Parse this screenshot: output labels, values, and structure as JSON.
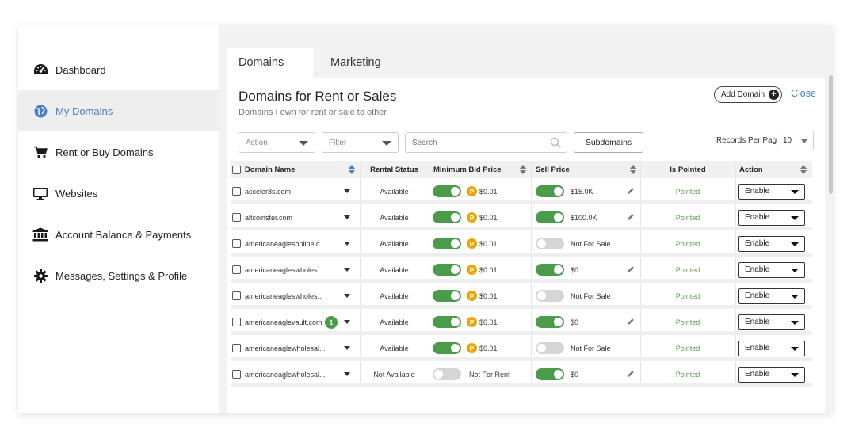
{
  "sidebar": {
    "items": [
      {
        "label": "Dashboard",
        "icon": "dashboard-icon"
      },
      {
        "label": "My Domains",
        "icon": "globe-icon"
      },
      {
        "label": "Rent or Buy Domains",
        "icon": "cart-icon"
      },
      {
        "label": "Websites",
        "icon": "monitor-icon"
      },
      {
        "label": "Account Balance & Payments",
        "icon": "bank-icon"
      },
      {
        "label": "Messages, Settings & Profile",
        "icon": "gear-icon"
      }
    ],
    "active_index": 1
  },
  "tabs": [
    {
      "label": "Domains",
      "active": true
    },
    {
      "label": "Marketing",
      "active": false
    }
  ],
  "panel": {
    "title": "Domains for Rent or Sales",
    "subtitle": "Domains I own for rent or sale to other",
    "add_domain_label": "Add Domain",
    "close_label": "Close"
  },
  "filters": {
    "action_placeholder": "Action",
    "filter_placeholder": "Filter",
    "search_placeholder": "Search",
    "subdomains_label": "Subdomains",
    "records_per_page_label": "Records Per Page",
    "records_per_page_value": "10"
  },
  "columns": {
    "domain_name": "Domain Name",
    "rental_status": "Rental Status",
    "min_bid": "Minimum Bid Price",
    "sell_price": "Sell Price",
    "is_pointed": "Is Pointed",
    "action": "Action"
  },
  "rows": [
    {
      "domain": "acceler8s.com",
      "badge": "",
      "rental": "Available",
      "rent_on": true,
      "bid": "$0.01",
      "sell_on": true,
      "sell": "$15.0K",
      "editable": true,
      "pointed": "Pointed",
      "action": "Enable"
    },
    {
      "domain": "altcoinster.com",
      "badge": "",
      "rental": "Available",
      "rent_on": true,
      "bid": "$0.01",
      "sell_on": true,
      "sell": "$100.0K",
      "editable": true,
      "pointed": "Pointed",
      "action": "Enable"
    },
    {
      "domain": "americaneaglesonline.c...",
      "badge": "",
      "rental": "Available",
      "rent_on": true,
      "bid": "$0.01",
      "sell_on": false,
      "sell": "Not For Sale",
      "editable": false,
      "pointed": "Pointed",
      "action": "Enable"
    },
    {
      "domain": "americaneagleswholes...",
      "badge": "",
      "rental": "Available",
      "rent_on": true,
      "bid": "$0.01",
      "sell_on": true,
      "sell": "$0",
      "editable": true,
      "pointed": "Pointed",
      "action": "Enable"
    },
    {
      "domain": "americaneagleswholes...",
      "badge": "",
      "rental": "Available",
      "rent_on": true,
      "bid": "$0.01",
      "sell_on": false,
      "sell": "Not For Sale",
      "editable": false,
      "pointed": "Pointed",
      "action": "Enable"
    },
    {
      "domain": "americaneaglevault.com",
      "badge": "1",
      "rental": "Available",
      "rent_on": true,
      "bid": "$0.01",
      "sell_on": true,
      "sell": "$0",
      "editable": true,
      "pointed": "Pointed",
      "action": "Enable"
    },
    {
      "domain": "americaneaglewholesal...",
      "badge": "",
      "rental": "Available",
      "rent_on": true,
      "bid": "$0.01",
      "sell_on": false,
      "sell": "Not For Sale",
      "editable": false,
      "pointed": "Pointed",
      "action": "Enable"
    },
    {
      "domain": "americaneaglewholesal...",
      "badge": "",
      "rental": "Not Available",
      "rent_on": false,
      "bid": "Not For Rent",
      "sell_on": true,
      "sell": "$0",
      "editable": true,
      "pointed": "Pointed",
      "action": "Enable"
    }
  ],
  "colors": {
    "accent": "#4a7fc1",
    "toggle_on": "#4a9b4a",
    "coin": "#f0a400",
    "pointed": "#5a9b4a"
  }
}
